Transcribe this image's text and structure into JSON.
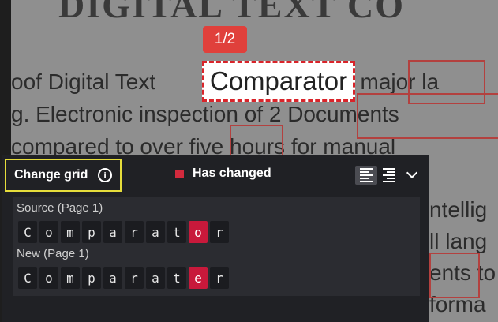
{
  "document": {
    "heading": "DIGITAL TEXT CO",
    "line1_before": "oof Digital Text",
    "line1_after": "is a major la",
    "line2": "g.  Electronic inspection of 2 Documents",
    "line3": "compared to over five hours for manual",
    "right_lines": [
      "ntellig",
      "ll lang",
      "ents to",
      "forma"
    ]
  },
  "match_badge": "1/2",
  "focus_word": "Comparator",
  "panel": {
    "title": "Change grid",
    "info_icon": "info-icon",
    "legend_label": "Has changed",
    "legend_color": "#d22a3d",
    "align_left_icon": "align-left-icon",
    "align_right_icon": "align-right-icon",
    "collapse_icon": "chevron-down-icon",
    "source_label": "Source (Page 1)",
    "new_label": "New (Page 1)",
    "source_chars": [
      "C",
      "o",
      "m",
      "p",
      "a",
      "r",
      "a",
      "t",
      "o",
      "r"
    ],
    "new_chars": [
      "C",
      "o",
      "m",
      "p",
      "a",
      "r",
      "a",
      "t",
      "e",
      "r"
    ],
    "changed_index": 8
  }
}
